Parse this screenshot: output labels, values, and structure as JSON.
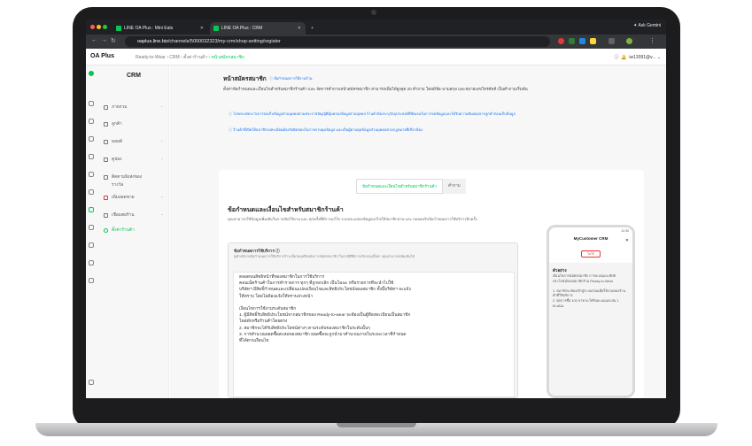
{
  "browser": {
    "tabs": [
      {
        "label": "LINE OA Plus : Mini Eats"
      },
      {
        "label": "LINE OA Plus : CRM"
      }
    ],
    "new_tab": "+",
    "gemini": "Ask Gemini",
    "url_host": "oaplus.line.biz",
    "url_path": "/channels/5000032323/my-crm/shop-setting/register"
  },
  "app": {
    "logo": "OA Plus",
    "breadcrumb": [
      "Ready-to-Wear",
      "CRM",
      "ตั้งค่าร้านค้า",
      "หน้าสมัครสมาชิก"
    ],
    "account": "iw13091@v..."
  },
  "sidebar": {
    "title": "CRM",
    "items": [
      {
        "label": "ภาพรวม",
        "icon": "dashboard-icon"
      },
      {
        "label": "ลูกค้า",
        "icon": "users-icon"
      },
      {
        "label": "พอยต์",
        "icon": "points-icon"
      },
      {
        "label": "คูปอง",
        "icon": "coupon-icon"
      },
      {
        "label": "ติดตามยิงส่งของ",
        "icon": "shipping-icon"
      },
      {
        "label": "รางวัล",
        "icon": "reward-icon"
      },
      {
        "label": "เพิ่มยอดขาย",
        "icon": "sales-icon"
      },
      {
        "label": "เชื่อมต่อร้าน",
        "icon": "store-icon"
      },
      {
        "label": "ตั้งค่าร้านค้า",
        "icon": "settings-icon"
      }
    ]
  },
  "page": {
    "title": "หน้าสมัครสมาชิก",
    "title_link": "ข้อกำหนดการใช้งานร้าน",
    "description": "ตั้งค่าข้อกำหนดและเงื่อนไขสำหรับสมาชิกร้านค้า และ จัดการคำถามหน้าสมัครสมาชิก สามารถเพิ่มได้สูงสุด 20 คำถาม โดยมีข้อ-นามสกุล และหมายเลขโทรศัพท์ เป็นคำถามเริ่มต้น",
    "note1": "โปรดระมัดระวังการขอเก็บข้อมูลส่วนบุคคลตามพระราชบัญญัติคุ้มครองข้อมูลส่วนบุคคล ร้านค้าต้องระบุวัตถุประสงค์ที่ชัดเจนในการขอข้อมูลและได้รับความยินยอมจากลูกค้าก่อนเก็บข้อมูล",
    "note2": "ร้านค้าที่เปิดให้สมาชิกลงทะเบียนต้องรับผิดชอบในการควบคุมข้อมูล และเป็นผู้ควบคุมข้อมูลส่วนบุคคลตามกฎหมายที่เกี่ยวข้อง",
    "tabs": [
      "ข้อกำหนดและเงื่อนไขสำหรับสมาชิกร้านค้า",
      "คำถาม"
    ],
    "card_title": "ข้อกำหนดและเงื่อนไขสำหรับสมาชิกร้านค้า",
    "card_sub": "คุณสามารถใช้ข้อมูลเพิ่มเติมในการเปิดใช้งาน และ ทุกครั้งที่มีการแก้ไข ระบบจะแสดงข้อมูลแก่ไขให้สมาชิกอ่าน และ กดยอมรับข้อกำหนดการใช้บริการอีกครั้ง",
    "terms_label": "ข้อกำหนดการใช้บริการ",
    "terms_hint": "ดูคำอธิบายข้อกำหนดการใช้บริการร้าน ทั้งก่อนหรือหลังการสมัครสมาชิก ในกรณีที่มีการปรับปรุงเนื้อหา คุณสามารถเพิ่มเติมได้",
    "terms_text": "ตลอดจนสิทธิหน้าที่ของสมาชิกในการใช้บริการ\nคอนเน็คร้านค้าในการทำรายการ ทุกๆ ที่ถูกยกเลิก เป็นโมฆะ หรือรายการที่จะนำไปใช้\nบริษัทฯ มีสิทธิ์กำหนดและเปลี่ยนแปลงเงื่อนไขและสิทธิประโยชน์ของสมาชิก ทั้งนี้บริษัทฯ จะแจ้ง\nให้ทราบ โดยไม่ต้องแจ้งให้ทราบล่วงหน้า\n\nเงื่อนไขการใช้งานระดับสมาชิก\n1. ผู้มีสิทธิ์รับสิทธิประโยชน์จากสมาชิกของ Ready-to-wear จะต้องเป็นผู้ที่ลงทะเบียนเป็นสมาชิก\nโดยพักหรือร้านค้าโดยตรง\n2. สมาชิกจะได้รับสิทธิประโยชน์ต่างๆ ตามระดับของสมาชิกในระดับนั้นๆ\n3. การคำนวณยอดซื้อสะสมของสมาชิก ยอดซื้อจะถูกนำมาคำนวณภายในระยะเวลาที่กำหนด\nที่ได้ตามเงื่อนไข",
    "preview": {
      "status": "12:30",
      "shop": "MyCustomer CRM",
      "close": "✕",
      "button": "โลโก้",
      "heading": "ตัวอย่าง",
      "body": "เงื่อนไขการสมัครสมาชิก การสะสมและสิทธิประโยชน์ของสมาชิกร้าน Ready-to-Wear\n\n1. สมาชิกจะต้องเข้าสู่ระบบก่อนเพื่อใช้งานของร้านค้าที่ใช้บริการ\n2. ทุกการซื้อ 100 บาท จะได้รับคะแนนสะสม 1 คะแนน"
    }
  }
}
